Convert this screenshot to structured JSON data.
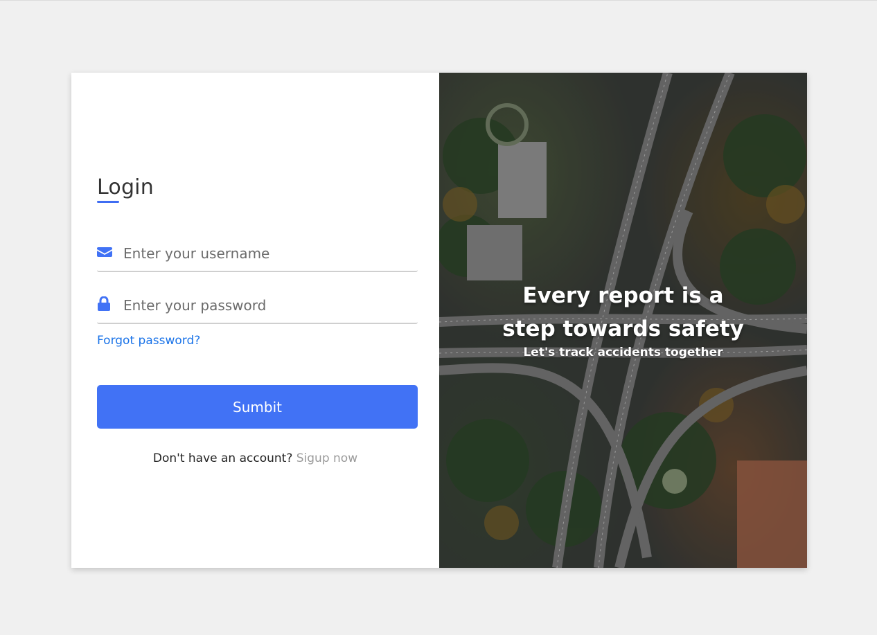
{
  "login": {
    "title": "Login",
    "username": {
      "placeholder": "Enter your username",
      "value": ""
    },
    "password": {
      "placeholder": "Enter your password",
      "value": ""
    },
    "forgot_label": "Forgot password?",
    "submit_label": "Sumbit",
    "signup_prompt": "Don't have an account?",
    "signup_link": "Sigup now"
  },
  "hero": {
    "headline_line1": "Every report is a",
    "headline_line2": "step towards safety",
    "subline": "Let's track accidents together"
  },
  "colors": {
    "accent": "#4172f5",
    "link": "#1a73e8",
    "page_bg": "#f0f0f0"
  },
  "icons": {
    "username": "envelope-icon",
    "password": "lock-icon"
  }
}
